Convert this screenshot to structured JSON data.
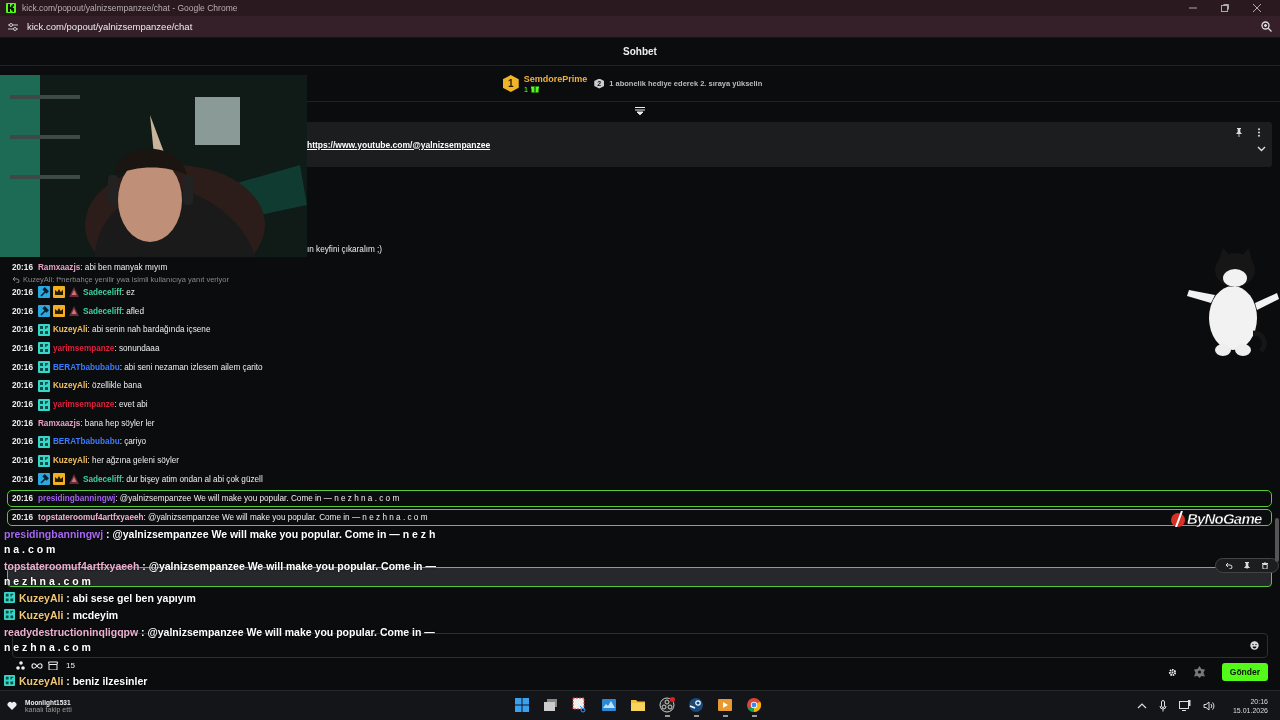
{
  "browser": {
    "title": "kick.com/popout/yalnizsempanzee/chat - Google Chrome",
    "url": "kick.com/popout/yalnizsempanzee/chat"
  },
  "chat_header": {
    "title": "Sohbet"
  },
  "leaderboard": {
    "rank": "1",
    "name": "SemdorePrime",
    "count": "1",
    "next_rank": "2",
    "hint": "1 abonelik hediye ederek 2. sıraya yükselin"
  },
  "pinned": {
    "link": "https://www.youtube.com/@yalnizsempanzee"
  },
  "messages": [
    {
      "kind": "partial",
      "text": "ın keyfini çıkaralım ;)"
    },
    {
      "kind": "chat",
      "time": "20:16",
      "name": "Ramxaazjs",
      "color": "#e6a3c4",
      "text": ": abi ben manyak mıyım"
    },
    {
      "kind": "reply",
      "text": "KuzeyAli: f*nerbahçe yenilir ywa isimli kullanıcıya yanıt veriyor"
    },
    {
      "kind": "chat",
      "time": "20:16",
      "badges": [
        {
          "kind": "moderator"
        },
        {
          "kind": "vip"
        },
        {
          "kind": "founder"
        }
      ],
      "name": "Sadeceliff",
      "color": "#3fd3a0",
      "text": ": ez"
    },
    {
      "kind": "chat",
      "time": "20:16",
      "badges": [
        {
          "kind": "moderator"
        },
        {
          "kind": "vip"
        },
        {
          "kind": "founder"
        }
      ],
      "name": "Sadeceliff",
      "color": "#3fd3a0",
      "text": ": afled"
    },
    {
      "kind": "chat",
      "time": "20:16",
      "badges": [
        {
          "kind": "og"
        }
      ],
      "name": "KuzeyAli",
      "color": "#f2c060",
      "text": ": abi senin nah bardağında içsene"
    },
    {
      "kind": "chat",
      "time": "20:16",
      "badges": [
        {
          "kind": "og"
        }
      ],
      "name": "yarimsempanze",
      "color": "#e0203e",
      "text": ": sonundaaa"
    },
    {
      "kind": "chat",
      "time": "20:16",
      "badges": [
        {
          "kind": "og"
        }
      ],
      "name": "BERATbabubabu",
      "color": "#3b7cff",
      "text": ": abi seni nezaman izlesem ailem çarito"
    },
    {
      "kind": "chat",
      "time": "20:16",
      "badges": [
        {
          "kind": "og"
        }
      ],
      "name": "KuzeyAli",
      "color": "#f2c060",
      "text": ": özellikle bana"
    },
    {
      "kind": "chat",
      "time": "20:16",
      "badges": [
        {
          "kind": "og"
        }
      ],
      "name": "yarimsempanze",
      "color": "#e0203e",
      "text": ": evet abi"
    },
    {
      "kind": "chat",
      "time": "20:16",
      "name": "Ramxaazjs",
      "color": "#e6a3c4",
      "text": ": bana hep söyler ler"
    },
    {
      "kind": "chat",
      "time": "20:16",
      "badges": [
        {
          "kind": "og"
        }
      ],
      "name": "BERATbabubabu",
      "color": "#3b7cff",
      "text": ": çariyo"
    },
    {
      "kind": "chat",
      "time": "20:16",
      "badges": [
        {
          "kind": "og"
        }
      ],
      "name": "KuzeyAli",
      "color": "#f2c060",
      "text": ": her ağzına geleni söyler"
    },
    {
      "kind": "chat",
      "time": "20:16",
      "badges": [
        {
          "kind": "moderator"
        },
        {
          "kind": "vip"
        },
        {
          "kind": "founder"
        }
      ],
      "name": "Sadeceliff",
      "color": "#3fd3a0",
      "text": ": dur bişey atim ondan al abi çok güzell"
    },
    {
      "kind": "highlight",
      "time": "20:16",
      "name": "presidingbanningwj",
      "color": "#a160f0",
      "text": ": @yalnizsempanzee We will make you popular. Come in — n e z h n a . c o m"
    },
    {
      "kind": "highlight",
      "time": "20:16",
      "name": "topstateroomuf4artfxyaeeh",
      "color": "#efb3d2",
      "text": ": @yalnizsempanzee We will make you popular. Come in — n e z h n a . c o m"
    },
    {
      "kind": "hovered",
      "actions": [
        {
          "kind": "reply"
        },
        {
          "kind": "pin"
        },
        {
          "kind": "delete"
        }
      ]
    }
  ],
  "stream_overlay": {
    "logo": "ByNoGame",
    "lines": [
      {
        "badge": false,
        "name": "presidingbanningwj",
        "color": "#a866f5",
        "text": " : @yalnizsempanzee We will make you popular. Come in — n e z h n a . c o m"
      },
      {
        "badge": false,
        "name": "topstateroomuf4artfxyaeeh",
        "color": "#ecb0cf",
        "text": " : @yalnizsempanzee We will make you popular. Come in — n e z h n a . c o m"
      },
      {
        "badge": true,
        "name": "KuzeyAli",
        "color": "#f2c878",
        "text": " : abi sese gel ben yapıyım"
      },
      {
        "badge": true,
        "name": "KuzeyAli",
        "color": "#f2c878",
        "text": " : mcdeyim"
      },
      {
        "badge": false,
        "name": "readydestructioninqligqpw",
        "color": "#ecb0cf",
        "text": " : @yalnizsempanzee We will make you popular. Come in — n e z h n a . c o m"
      },
      {
        "badge": true,
        "name": "KuzeyAli",
        "color": "#f2c878",
        "text": " : beniz ilzesinler"
      }
    ]
  },
  "chat_footer": {
    "points": "15",
    "send": "Gönder"
  },
  "notification": {
    "user": "Moonlight1531",
    "action": "kanalı takip etti"
  },
  "taskbar": {
    "apps": [
      {
        "kind": "start",
        "running": false
      },
      {
        "kind": "taskview",
        "running": false
      },
      {
        "kind": "snip",
        "running": false
      },
      {
        "kind": "monitor",
        "running": false
      },
      {
        "kind": "folder",
        "running": false
      },
      {
        "kind": "obs",
        "running": true
      },
      {
        "kind": "steam",
        "running": true
      },
      {
        "kind": "player",
        "running": true
      },
      {
        "kind": "chrome",
        "running": true
      }
    ],
    "time": "20:16",
    "date": "15.01.2026"
  }
}
